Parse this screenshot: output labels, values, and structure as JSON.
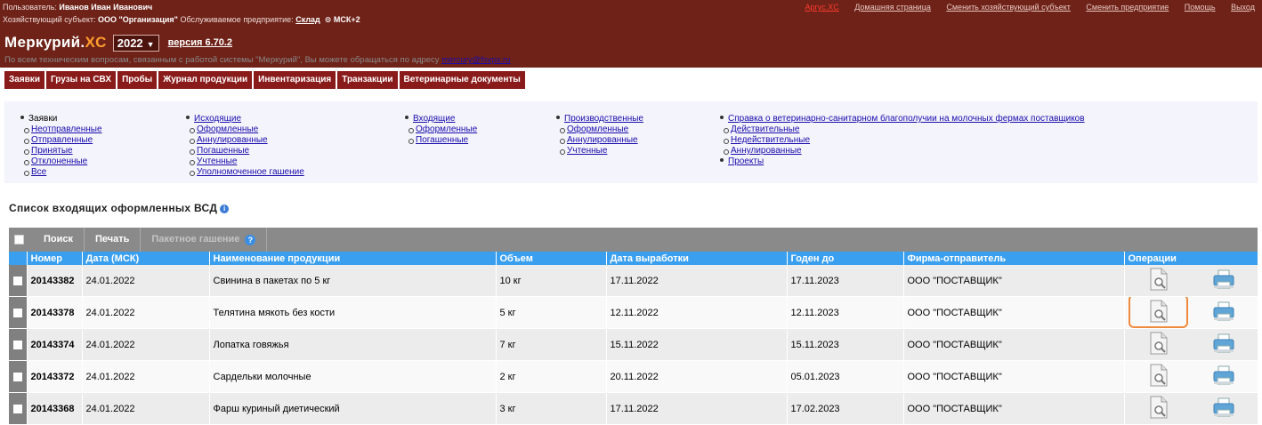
{
  "header": {
    "user_label": "Пользователь:",
    "user_name": "Иванов Иван Иванович",
    "subject_label": "Хозяйствующий субъект:",
    "subject_name": "ООО \"Организация\"",
    "enterprise_label": "Обслуживаемое предприятие:",
    "enterprise_name": "Склад",
    "timezone": "МСК+2",
    "links": [
      "Аргус.XC",
      "Домашняя страница",
      "Сменить хозяйствующий субъект",
      "Сменить предприятие",
      "Помощь",
      "Выход"
    ]
  },
  "app": {
    "name_main": "Меркурий.",
    "name_suffix": "XC",
    "year": "2022",
    "version": "версия 6.70.2"
  },
  "support": {
    "text": "По всем техническим вопросам, связанным с работой системы \"Меркурий\", Вы можете обращаться по адресу",
    "email": "mercury@fsvps.ru"
  },
  "nav": [
    "Заявки",
    "Грузы на СВХ",
    "Пробы",
    "Журнал продукции",
    "Инвентаризация",
    "Транзакции",
    "Ветеринарные документы"
  ],
  "menu": {
    "col1": {
      "head": "Заявки",
      "items": [
        "Неотправленные",
        "Отправленные",
        "Принятые",
        "Отклоненные",
        "Все"
      ]
    },
    "col2": {
      "head": "Исходящие",
      "items": [
        "Оформленные",
        "Аннулированные",
        "Погашенные",
        "Учтенные",
        "Уполномоченное гашение"
      ]
    },
    "col3": {
      "head": "Входящие",
      "items": [
        "Оформленные",
        "Погашенные"
      ]
    },
    "col4": {
      "head": "Производственные",
      "items": [
        "Оформленные",
        "Аннулированные",
        "Учтенные"
      ]
    },
    "col5": {
      "head": "Справка о ветеринарно-санитарном благополучии на молочных фермах поставщиков",
      "items": [
        "Действительные",
        "Недействительные",
        "Аннулированные"
      ],
      "extra": "Проекты"
    }
  },
  "list": {
    "title": "Список входящих оформленных ВСД",
    "toolbar": {
      "search": "Поиск",
      "print": "Печать",
      "batch": "Пакетное гашение"
    },
    "columns": [
      "Номер",
      "Дата (МСК)",
      "Наименование продукции",
      "Объем",
      "Дата выработки",
      "Годен до",
      "Фирма-отправитель",
      "Операции"
    ],
    "rows": [
      {
        "num": "20143382",
        "date": "24.01.2022",
        "product": "Свинина в пакетах по 5 кг",
        "volume": "10 кг",
        "produced": "17.11.2022",
        "expires": "17.11.2023",
        "sender": "ООО \"ПОСТАВЩИК\""
      },
      {
        "num": "20143378",
        "date": "24.01.2022",
        "product": "Телятина мякоть без кости",
        "volume": "5 кг",
        "produced": "12.11.2022",
        "expires": "12.11.2023",
        "sender": "ООО \"ПОСТАВЩИК\""
      },
      {
        "num": "20143374",
        "date": "24.01.2022",
        "product": "Лопатка говяжья",
        "volume": "7 кг",
        "produced": "15.11.2022",
        "expires": "15.11.2023",
        "sender": "ООО \"ПОСТАВЩИК\""
      },
      {
        "num": "20143372",
        "date": "24.01.2022",
        "product": "Сардельки молочные",
        "volume": "2 кг",
        "produced": "20.11.2022",
        "expires": "05.01.2023",
        "sender": "ООО \"ПОСТАВЩИК\""
      },
      {
        "num": "20143368",
        "date": "24.01.2022",
        "product": "Фарш куриный диетический",
        "volume": "3 кг",
        "produced": "17.11.2022",
        "expires": "17.02.2023",
        "sender": "ООО \"ПОСТАВЩИК\""
      }
    ],
    "highlighted_row": 1
  },
  "colors": {
    "header_bg": "#6e2218",
    "nav_tab": "#8a1b1b",
    "table_header": "#3a9fee",
    "highlight": "#f08a3c"
  }
}
